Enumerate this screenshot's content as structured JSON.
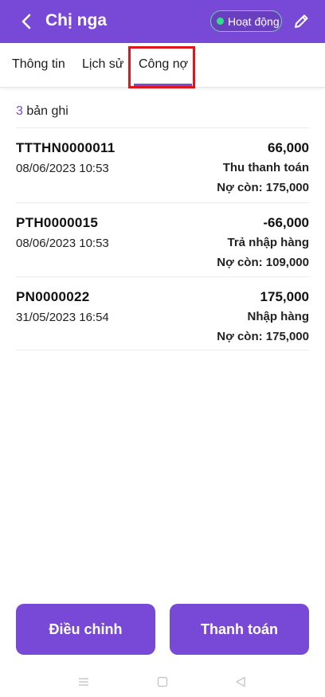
{
  "header": {
    "title": "Chị nga",
    "status": "Hoạt động",
    "colors": {
      "primary": "#7848d6",
      "status_dot": "#2ee08a"
    }
  },
  "tabs": [
    {
      "label": "Thông tin"
    },
    {
      "label": "Lịch sử"
    },
    {
      "label": "Công nợ",
      "active": true
    }
  ],
  "records": {
    "count": "3",
    "count_suffix": " bản ghi"
  },
  "transactions": [
    {
      "code": "TTTHN0000011",
      "datetime": "08/06/2023 10:53",
      "amount": "66,000",
      "type": "Thu thanh toán",
      "debt": "Nợ còn: 175,000"
    },
    {
      "code": "PTH0000015",
      "datetime": "08/06/2023 10:53",
      "amount": "-66,000",
      "type": "Trả nhập hàng",
      "debt": "Nợ còn: 109,000"
    },
    {
      "code": "PN0000022",
      "datetime": "31/05/2023 16:54",
      "amount": "175,000",
      "type": "Nhập hàng",
      "debt": "Nợ còn: 175,000"
    }
  ],
  "actions": {
    "adjust_label": "Điều chỉnh",
    "pay_label": "Thanh toán"
  },
  "navbar": {
    "icons": [
      "menu-icon",
      "home-square-icon",
      "back-triangle-icon"
    ]
  }
}
